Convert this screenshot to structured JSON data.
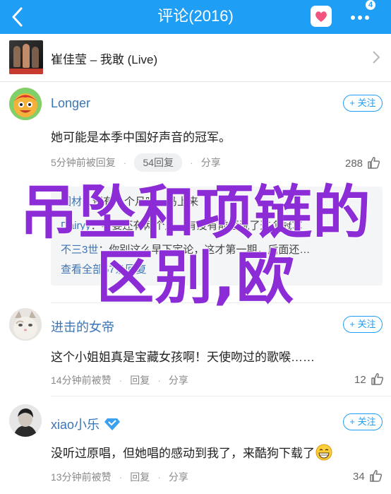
{
  "header": {
    "title": "评论(2016)",
    "badge": "4"
  },
  "song": {
    "title": "崔佳莹 – 我敢 (Live)"
  },
  "comments": [
    {
      "user": "Longer",
      "follow": "+ 关注",
      "text": "她可能是本季中国好声音的冠军。",
      "time": "5分钟前被回复",
      "reply_count": "54回复",
      "share": "分享",
      "likes": "288"
    },
    {
      "user": "进击的女帝",
      "follow": "+ 关注",
      "text": "这个小姐姐真是宝藏女孩啊！天使吻过的歌喉……",
      "time": "14分钟前被赞",
      "reply": "回复",
      "share": "分享",
      "likes": "12"
    },
    {
      "user": "xiao小乐",
      "follow": "+ 关注",
      "text": "没听过原唱，但她唱的感动到我了，来酷狗下载了",
      "time": "13分钟前被赞",
      "reply": "回复",
      "share": "分享",
      "likes": "34"
    }
  ],
  "replies": {
    "line1_name": "因材",
    "line1_text": "：还有一个月吗，马上来",
    "line2_name": "Dairyy",
    "line2_text": "：不要还有两个月，有没有前面说了这个冠军",
    "line3_name": "不三3世",
    "line3_text": "：你别这么早下定论，这才第一期，后面还…",
    "more": "查看全部57条回复"
  },
  "overlay": {
    "line1": "吊坠和项链的",
    "line2": "区别,欧"
  },
  "colors": {
    "nav": "#1e9ef5",
    "link": "#3b75b5",
    "overlay": "#8b2cd6"
  },
  "icons": [
    "back-arrow-icon",
    "heart-icon",
    "more-icon",
    "chevron-right-icon",
    "thumb-up-icon",
    "verified-diamond-icon",
    "grin-emoji-icon"
  ]
}
